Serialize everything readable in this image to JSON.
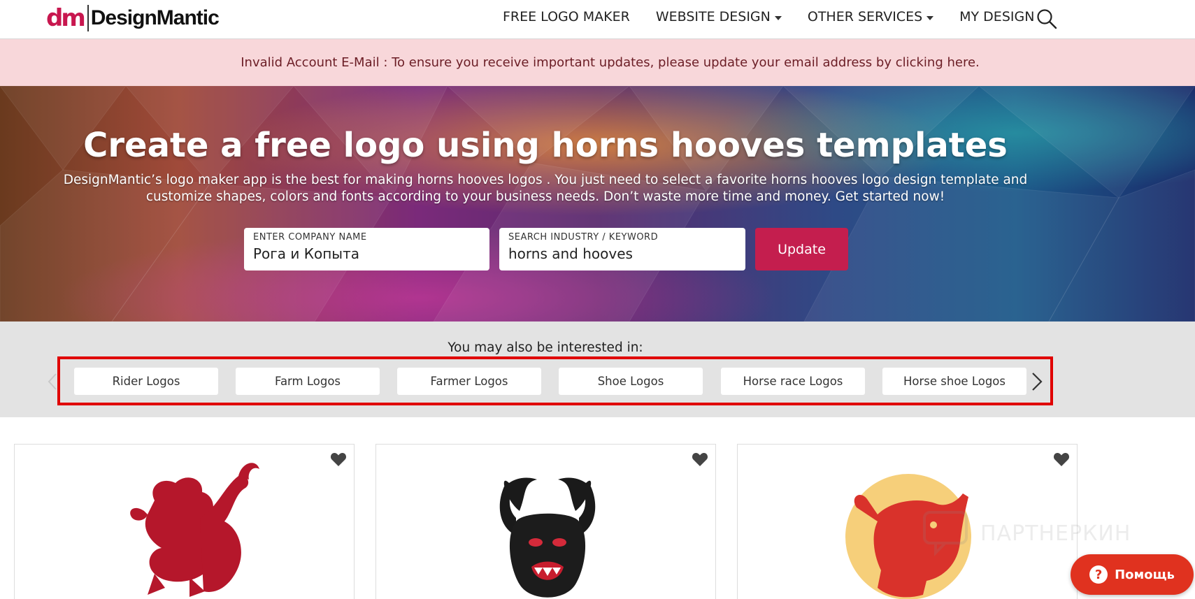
{
  "header": {
    "logo_mark": "dm",
    "logo_text": "DesignMantic",
    "nav": [
      {
        "label": "FREE LOGO MAKER",
        "dropdown": false
      },
      {
        "label": "WEBSITE DESIGN",
        "dropdown": true
      },
      {
        "label": "OTHER SERVICES",
        "dropdown": true
      },
      {
        "label": "MY DESIGN",
        "dropdown": false
      }
    ],
    "search_icon": "search-icon"
  },
  "alert": {
    "text": "Invalid Account E-Mail : To ensure you receive important updates, please update your email address by clicking here."
  },
  "hero": {
    "title": "Create a free logo using horns hooves templates",
    "subtitle": "DesignMantic’s logo maker app is the best for making horns hooves logos . You just need to select a favorite horns hooves logo design template and customize shapes, colors and fonts according to your business needs. Don’t waste more time and money. Get started now!",
    "company_label": "ENTER COMPANY NAME",
    "company_value": "Рога и Копыта",
    "keyword_label": "SEARCH INDUSTRY / KEYWORD",
    "keyword_value": "horns and hooves",
    "update_label": "Update"
  },
  "interested": {
    "title": "You may also be interested in:",
    "chips": [
      "Rider Logos",
      "Farm Logos",
      "Farmer Logos",
      "Shoe Logos",
      "Horse race Logos",
      "Horse shoe Logos"
    ]
  },
  "cards": [
    {
      "icon": "red-dragon-logo",
      "favorite_icon": "heart-icon"
    },
    {
      "icon": "horned-beast-logo",
      "favorite_icon": "heart-icon"
    },
    {
      "icon": "bull-head-logo",
      "favorite_icon": "heart-icon"
    }
  ],
  "watermark": {
    "text": "ПАРТНЕРКИН"
  },
  "help": {
    "label": "Помощь",
    "icon": "?"
  },
  "colors": {
    "brand": "#c8174f",
    "update_button": "#c41e4e",
    "alert_bg": "#f8d7da",
    "alert_text": "#6b1d25",
    "highlight_border": "#e00000",
    "help_button": "#e0321f"
  }
}
